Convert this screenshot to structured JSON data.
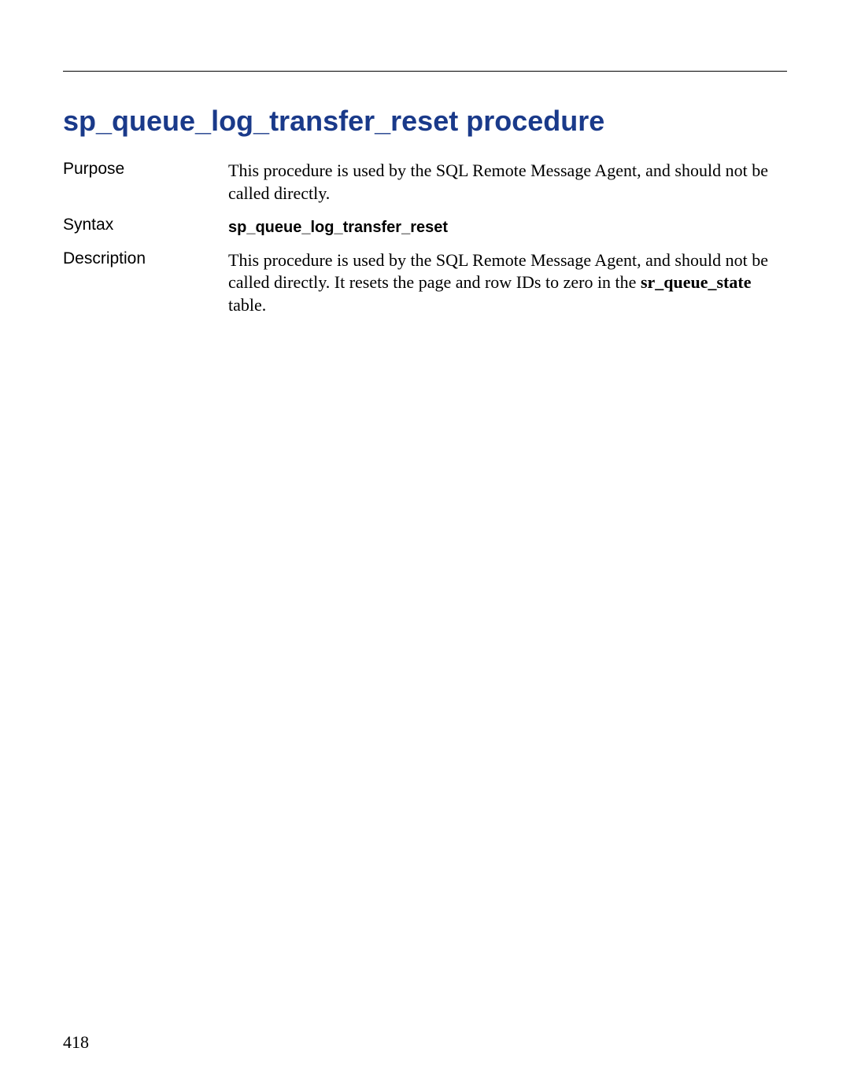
{
  "title": "sp_queue_log_transfer_reset procedure",
  "sections": {
    "purpose": {
      "label": "Purpose",
      "text": "This procedure is used by the SQL Remote Message Agent, and should not be called directly."
    },
    "syntax": {
      "label": "Syntax",
      "text": "sp_queue_log_transfer_reset"
    },
    "description": {
      "label": "Description",
      "text_part1": "This procedure is used by the SQL Remote Message Agent, and should not be called directly. It resets the page and row IDs to zero in the ",
      "bold_part": "sr_queue_state",
      "text_part2": " table."
    }
  },
  "page_number": "418"
}
